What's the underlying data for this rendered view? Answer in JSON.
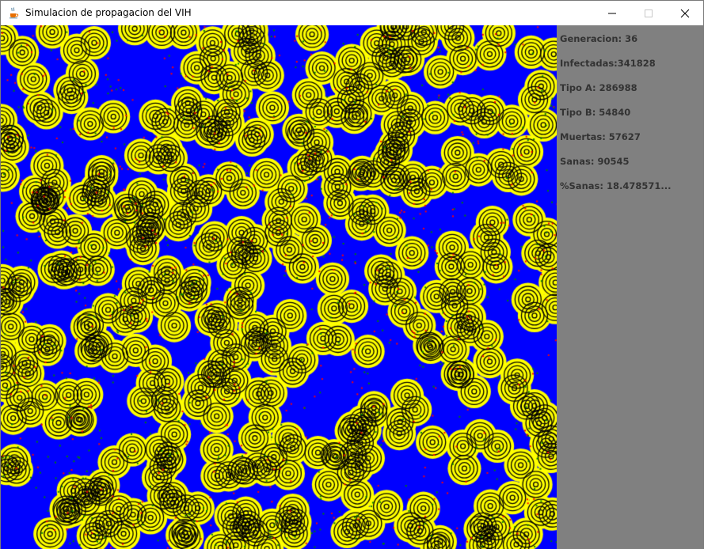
{
  "window": {
    "title": "Simulacion de propagacion del VIH",
    "icons": {
      "app": "java-cup-icon",
      "minimize": "minimize-icon",
      "maximize": "maximize-icon",
      "close": "close-icon"
    }
  },
  "canvas": {
    "colors": {
      "healthy": "#0000ff",
      "infected": "#ffff00",
      "ring": "#000000",
      "type_b": "#ff0000",
      "dead": "#008000"
    }
  },
  "stats": {
    "generation": "Generacion: 36",
    "infected": "Infectadas:341828",
    "type_a": "Tipo A: 286988",
    "type_b": "Tipo B: 54840",
    "dead": "Muertas: 57627",
    "healthy": "Sanas: 90545",
    "healthy_pct": "%Sanas: 18.478571..."
  }
}
